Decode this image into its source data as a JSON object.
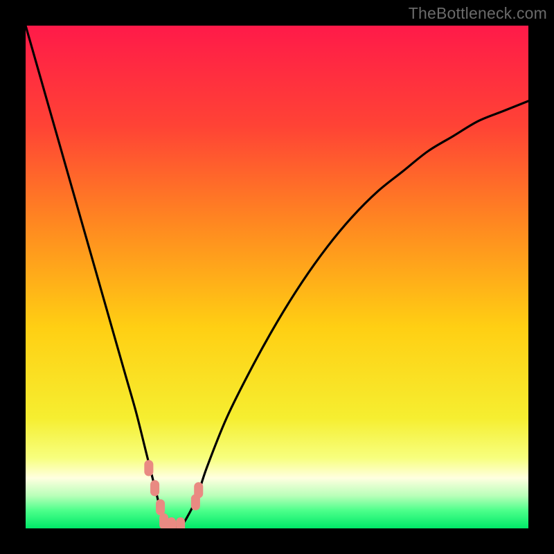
{
  "watermark": {
    "text": "TheBottleneck.com"
  },
  "chart_data": {
    "type": "line",
    "title": "",
    "xlabel": "",
    "ylabel": "",
    "xlim": [
      0,
      100
    ],
    "ylim": [
      0,
      100
    ],
    "grid": false,
    "legend": false,
    "background_gradient_stops": [
      {
        "pos": 0.0,
        "color": "#ff1a49"
      },
      {
        "pos": 0.2,
        "color": "#ff4335"
      },
      {
        "pos": 0.4,
        "color": "#ff8a20"
      },
      {
        "pos": 0.6,
        "color": "#ffcf13"
      },
      {
        "pos": 0.78,
        "color": "#f6ee30"
      },
      {
        "pos": 0.86,
        "color": "#f7ff7e"
      },
      {
        "pos": 0.9,
        "color": "#ffffe0"
      },
      {
        "pos": 0.935,
        "color": "#b9ffb9"
      },
      {
        "pos": 0.965,
        "color": "#4bff8a"
      },
      {
        "pos": 1.0,
        "color": "#00e868"
      }
    ],
    "series": [
      {
        "name": "bottleneck-curve",
        "comment": "V-shaped curve; y is bottleneck magnitude (0 at optimum). x is component-ratio axis.",
        "x": [
          0,
          2,
          4,
          6,
          8,
          10,
          12,
          14,
          16,
          18,
          20,
          22,
          24,
          26,
          27,
          28,
          29,
          30,
          31,
          32,
          34,
          36,
          40,
          45,
          50,
          55,
          60,
          65,
          70,
          75,
          80,
          85,
          90,
          95,
          100
        ],
        "y": [
          100,
          93,
          86,
          79,
          72,
          65,
          58,
          51,
          44,
          37,
          30,
          23,
          15,
          7,
          3,
          0.7,
          0.2,
          0.2,
          0.7,
          2,
          6,
          12,
          22,
          32,
          41,
          49,
          56,
          62,
          67,
          71,
          75,
          78,
          81,
          83,
          85
        ]
      }
    ],
    "markers": {
      "comment": "salmon rounded markers near the curve minimum",
      "color": "#e98a82",
      "points": [
        {
          "x": 24.5,
          "y": 12
        },
        {
          "x": 25.7,
          "y": 8
        },
        {
          "x": 26.8,
          "y": 4.2
        },
        {
          "x": 27.5,
          "y": 1.4
        },
        {
          "x": 29.0,
          "y": 0.6
        },
        {
          "x": 30.8,
          "y": 0.6
        },
        {
          "x": 33.8,
          "y": 5.2
        },
        {
          "x": 34.4,
          "y": 7.6
        }
      ]
    }
  }
}
